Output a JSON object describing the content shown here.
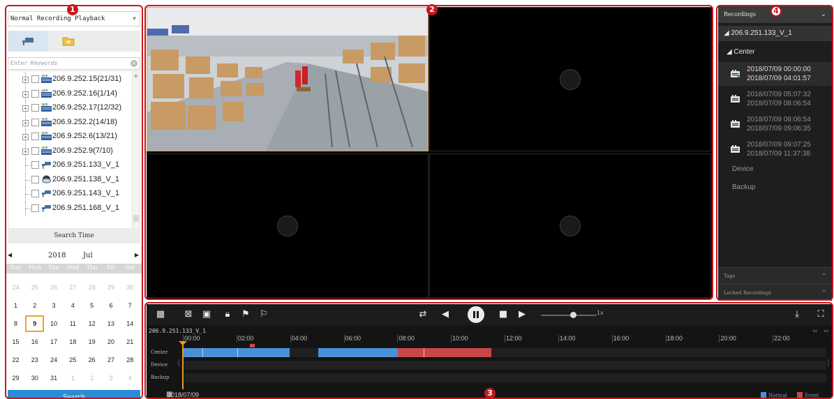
{
  "annotations": {
    "b1": "1",
    "b2": "2",
    "b3": "3",
    "b4": "4"
  },
  "left": {
    "mode": "Normal Recording Playback",
    "search_placeholder": "Enter Keywords",
    "tree": [
      {
        "label": "206.9.252.15(21/31)",
        "type": "nvr"
      },
      {
        "label": "206.9.252.16(1/14)",
        "type": "nvr"
      },
      {
        "label": "206.9.252.17(12/32)",
        "type": "nvr"
      },
      {
        "label": "206.9.252.2(14/18)",
        "type": "nvr"
      },
      {
        "label": "206.9.252.6(13/21)",
        "type": "nvr"
      },
      {
        "label": "206.9.252.9(7/10)",
        "type": "nvr"
      },
      {
        "label": "206.9.251.133_V_1",
        "type": "camera"
      },
      {
        "label": "206.9.251.138_V_1",
        "type": "dome"
      },
      {
        "label": "206.9.251.143_V_1",
        "type": "camera"
      },
      {
        "label": "206.9.251.168_V_1",
        "type": "camera"
      }
    ],
    "nvr_tag": "NVR",
    "search_time": "Search Time",
    "calendar": {
      "year": "2018",
      "month": "Jul",
      "dow": [
        "Sun",
        "Mon",
        "Tue",
        "Wed",
        "Thu",
        "Fri",
        "Sat"
      ],
      "weeks": [
        [
          "24",
          "25",
          "26",
          "27",
          "28",
          "29",
          "30"
        ],
        [
          "1",
          "2",
          "3",
          "4",
          "5",
          "6",
          "7"
        ],
        [
          "8",
          "9",
          "10",
          "11",
          "12",
          "13",
          "14"
        ],
        [
          "15",
          "16",
          "17",
          "18",
          "19",
          "20",
          "21"
        ],
        [
          "22",
          "23",
          "24",
          "25",
          "26",
          "27",
          "28"
        ],
        [
          "29",
          "30",
          "31",
          "1",
          "2",
          "3",
          "4"
        ]
      ],
      "selected": "9"
    },
    "search_button": "Search"
  },
  "right": {
    "header": "Recordings",
    "camera": "206.9.251.133_V_1",
    "group": "Center",
    "recordings": [
      {
        "start": "2018/07/09  00:00:00",
        "end": "2018/07/09  04:01:57"
      },
      {
        "start": "2018/07/09  05:07:32",
        "end": "2018/07/09  08:06:54"
      },
      {
        "start": "2018/07/09  08:06:54",
        "end": "2018/07/09  09:06:35"
      },
      {
        "start": "2018/07/09  09:07:25",
        "end": "2018/07/09  11:37:38"
      }
    ],
    "device": "Device",
    "backup": "Backup",
    "tags": "Tags",
    "locked": "Locked Recordings"
  },
  "timeline": {
    "camera": "206.9.251.133_V_1",
    "speed": "1x",
    "ticks": [
      "00:00",
      "02:00",
      "04:00",
      "06:00",
      "08:00",
      "10:00",
      "12:00",
      "14:00",
      "16:00",
      "18:00",
      "20:00",
      "22:00"
    ],
    "rows": [
      "Center",
      "Device",
      "Backup"
    ],
    "date": "2018/07/09",
    "legend_normal": "Normal",
    "legend_event": "Event",
    "colors": {
      "normal": "#4a90d9",
      "event": "#c94747"
    }
  }
}
